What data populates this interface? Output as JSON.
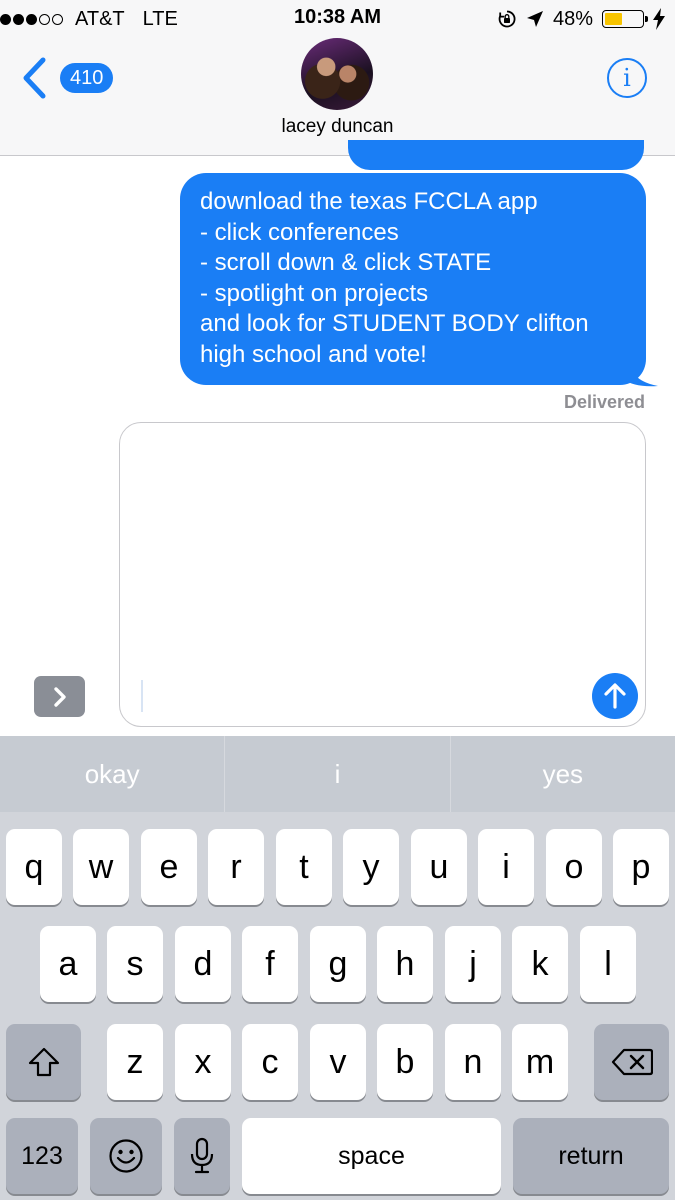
{
  "status_bar": {
    "carrier": "AT&T",
    "network": "LTE",
    "time": "10:38 AM",
    "battery_percent": "48%",
    "battery_level": 0.48,
    "icons": [
      "signal-dots-icon",
      "orientation-lock-icon",
      "location-arrow-icon",
      "battery-icon",
      "charging-bolt-icon"
    ]
  },
  "nav": {
    "back_count": "410",
    "contact_name": "lacey duncan",
    "info_glyph": "i",
    "icons": [
      "back-chevron-icon",
      "info-icon"
    ]
  },
  "messages": [
    {
      "direction": "sent",
      "lines": [
        "download the texas FCCLA app",
        "- click conferences",
        "- scroll down & click STATE",
        "- spotlight on projects",
        "and look for STUDENT BODY clifton",
        "high school and vote!"
      ]
    }
  ],
  "delivery_status": "Delivered",
  "compose": {
    "value": "",
    "icons": [
      "expand-chevron-icon",
      "send-arrow-icon"
    ]
  },
  "keyboard": {
    "predictions": [
      "okay",
      "i",
      "yes"
    ],
    "rows": [
      [
        "q",
        "w",
        "e",
        "r",
        "t",
        "y",
        "u",
        "i",
        "o",
        "p"
      ],
      [
        "a",
        "s",
        "d",
        "f",
        "g",
        "h",
        "j",
        "k",
        "l"
      ],
      [
        "z",
        "x",
        "c",
        "v",
        "b",
        "n",
        "m"
      ]
    ],
    "numbers_label": "123",
    "space_label": "space",
    "return_label": "return",
    "icons": [
      "shift-icon",
      "delete-icon",
      "emoji-icon",
      "microphone-icon"
    ]
  },
  "colors": {
    "accent_blue": "#1a7ef5",
    "battery_yellow": "#f7c400",
    "keyboard_bg": "#d1d4da",
    "key_dark": "#abb0bb",
    "delivered_gray": "#8e8e93"
  }
}
